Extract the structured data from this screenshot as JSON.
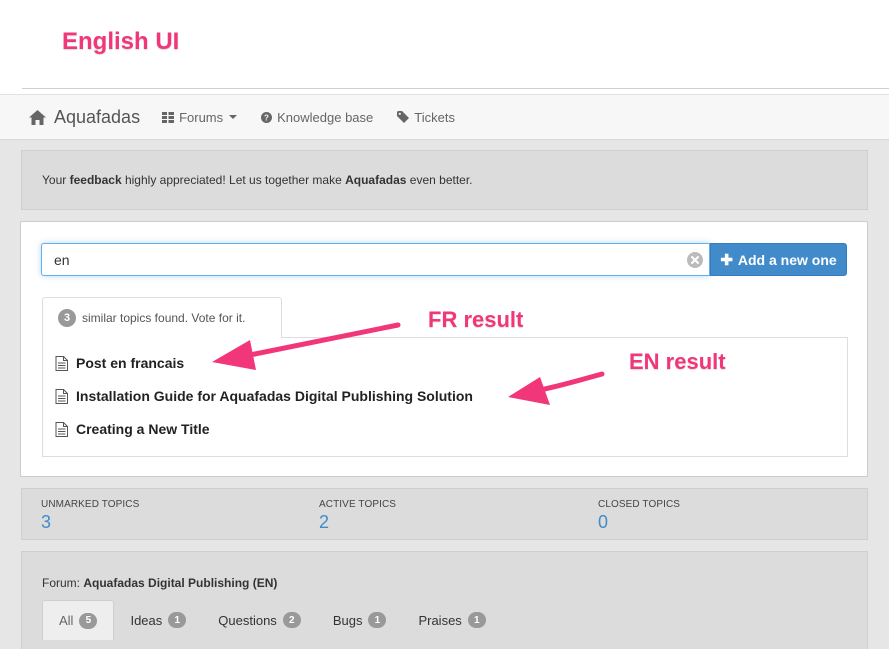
{
  "banner": {
    "label": "English UI"
  },
  "navbar": {
    "brand": "Aquafadas",
    "items": [
      {
        "label": "Forums",
        "icon": "grid-icon"
      },
      {
        "label": "Knowledge base",
        "icon": "question-circle-icon"
      },
      {
        "label": "Tickets",
        "icon": "tag-icon"
      }
    ]
  },
  "feedback": {
    "part1": "Your ",
    "bold1": "feedback",
    "part2": " highly appreciated! Let us together make ",
    "bold2": "Aquafadas",
    "part3": " even better."
  },
  "search": {
    "value": "en",
    "add_button_label": "Add a new one",
    "similar_count": "3",
    "similar_text": "similar topics found. Vote for it.",
    "results": [
      "Post en francais",
      "Installation Guide for Aquafadas Digital Publishing Solution",
      "Creating a New Title"
    ]
  },
  "annotations": {
    "fr": "FR result",
    "en": "EN result",
    "color": "#f2367a"
  },
  "stats": [
    {
      "label": "UNMARKED TOPICS",
      "value": "3"
    },
    {
      "label": "ACTIVE TOPICS",
      "value": "2"
    },
    {
      "label": "CLOSED TOPICS",
      "value": "0"
    }
  ],
  "forum": {
    "prefix": "Forum: ",
    "name": "Aquafadas Digital Publishing (EN)",
    "tabs": [
      {
        "label": "All",
        "count": "5"
      },
      {
        "label": "Ideas",
        "count": "1"
      },
      {
        "label": "Questions",
        "count": "2"
      },
      {
        "label": "Bugs",
        "count": "1"
      },
      {
        "label": "Praises",
        "count": "1"
      }
    ]
  },
  "colors": {
    "accent": "#428bca",
    "annotation": "#f2367a"
  }
}
